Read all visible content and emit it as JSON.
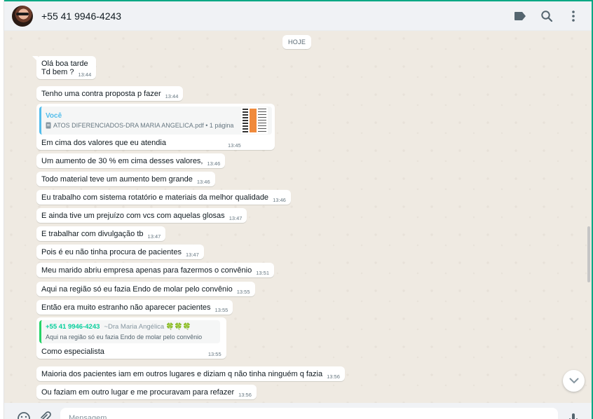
{
  "header": {
    "contact_name": "+55 41 9946-4243",
    "icons": [
      "label-icon",
      "search-icon",
      "menu-icon"
    ]
  },
  "chat": {
    "day_badge": "HOJE",
    "messages": [
      {
        "lines": [
          "Olá boa tarde",
          "Td bem ?"
        ],
        "time": "13:44"
      },
      {
        "text": "Tenho uma contra proposta p fazer",
        "time": "13:44"
      },
      {
        "quote": {
          "sender": "Você",
          "file": "ATOS DIFERENCIADOS-DRA MARIA ANGELICA.pdf • 1 página"
        },
        "text": "Em cima dos valores que eu atendia",
        "time": "13:45"
      },
      {
        "text": "Um aumento de 30 % em cima desses valores,",
        "time": "13:46"
      },
      {
        "text": "Todo material teve um aumento bem grande",
        "time": "13:46"
      },
      {
        "text": "Eu trabalho com sistema rotatório e materiais da melhor qualidade",
        "time": "13:46"
      },
      {
        "text": "E ainda tive um prejuízo com vcs com aquelas glosas",
        "time": "13:47"
      },
      {
        "text": "E trabalhar com divulgação tb",
        "time": "13:47"
      },
      {
        "text": "Pois é eu não tinha procura de pacientes",
        "time": "13:47"
      },
      {
        "text": "Meu marido abriu empresa apenas para fazermos o convênio",
        "time": "13:51"
      },
      {
        "text": "Aqui na região só eu fazia Endo de molar pelo convênio",
        "time": "13:55"
      },
      {
        "text": "Então era muito estranho não aparecer pacientes",
        "time": "13:55"
      },
      {
        "reply": {
          "sender": "+55 41 9946-4243",
          "alias": "~Dra Maria Angélica 🍀🍀🍀",
          "text": "Aqui na região só eu fazia Endo de molar pelo convênio"
        },
        "text": "Como especialista",
        "time": "13:55"
      },
      {
        "text": "Maioria dos pacientes iam em outros lugares e diziam q não tinha ninguém q fazia",
        "time": "13:56"
      },
      {
        "text": "Ou faziam em outro lugar e me procuravam para refazer",
        "time": "13:56"
      }
    ]
  },
  "footer": {
    "placeholder": "Mensagem"
  },
  "colors": {
    "accent": "#00a884",
    "quote_you": "#53bdeb",
    "quote_contact": "#06cf9c",
    "chat_bg": "#efeae2"
  }
}
